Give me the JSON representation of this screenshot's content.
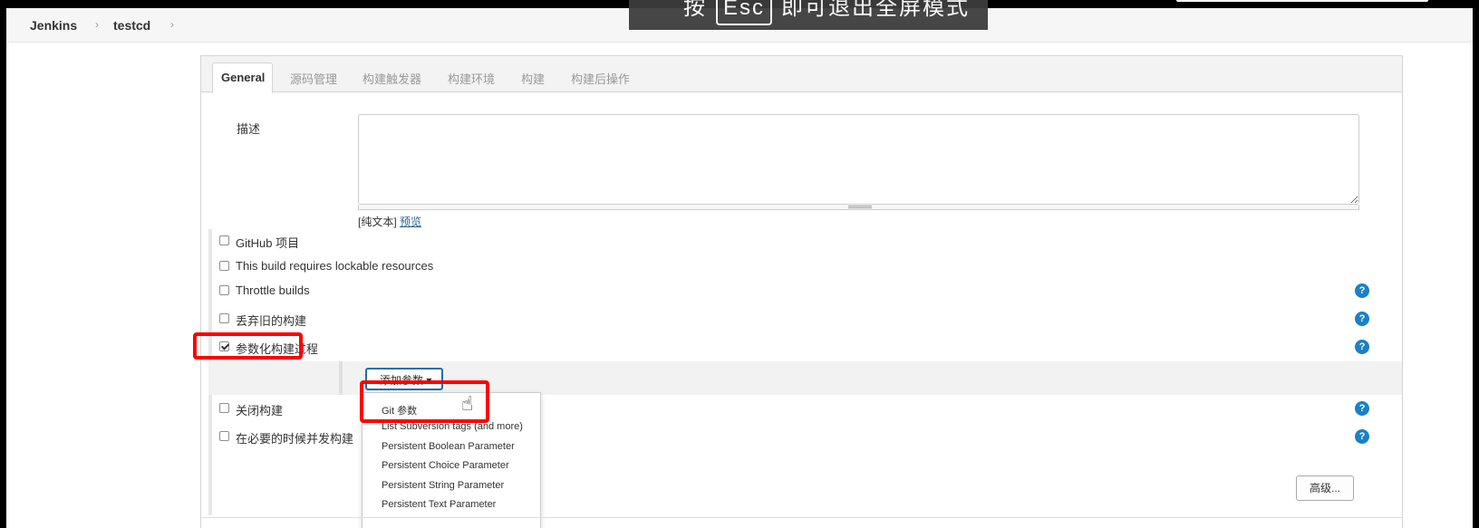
{
  "breadcrumb": {
    "items": [
      "Jenkins",
      "testcd"
    ],
    "separator": "›"
  },
  "fullscreen_notice": {
    "prefix": "按",
    "key": "Esc",
    "suffix": "即可退出全屏模式"
  },
  "tabs": [
    {
      "label": "General",
      "active": true
    },
    {
      "label": "源码管理",
      "active": false
    },
    {
      "label": "构建触发器",
      "active": false
    },
    {
      "label": "构建环境",
      "active": false
    },
    {
      "label": "构建",
      "active": false
    },
    {
      "label": "构建后操作",
      "active": false
    }
  ],
  "description": {
    "label": "描述",
    "value": "",
    "markup_prefix": "[纯文本]",
    "preview_link": "预览"
  },
  "options": [
    {
      "label": "GitHub 项目",
      "checked": false,
      "help": false
    },
    {
      "label": "This build requires lockable resources",
      "checked": false,
      "help": false
    },
    {
      "label": "Throttle builds",
      "checked": false,
      "help": true
    },
    {
      "label": "丢弃旧的构建",
      "checked": false,
      "help": true
    },
    {
      "label": "参数化构建过程",
      "checked": true,
      "help": true
    },
    {
      "label": "关闭构建",
      "checked": false,
      "help": true
    },
    {
      "label": "在必要的时候并发构建",
      "checked": false,
      "help": true
    }
  ],
  "help_icon_glyph": "?",
  "add_param_button": {
    "label": "添加参数",
    "caret": "▾"
  },
  "param_dropdown": {
    "items": [
      "Git 参数",
      "List Subversion tags (and more)",
      "Persistent Boolean Parameter",
      "Persistent Choice Parameter",
      "Persistent String Parameter",
      "Persistent Text Parameter"
    ]
  },
  "advanced_button": {
    "label": "高级..."
  },
  "colors": {
    "highlight": "#ff0000",
    "help_icon": "#1b80c6",
    "link": "#2a6496",
    "button_focus_border": "#1b6fb0"
  },
  "icons": {
    "cursor": "hand-pointer-icon",
    "help": "help-icon",
    "breadcrumb_sep": "chevron-right-icon"
  }
}
